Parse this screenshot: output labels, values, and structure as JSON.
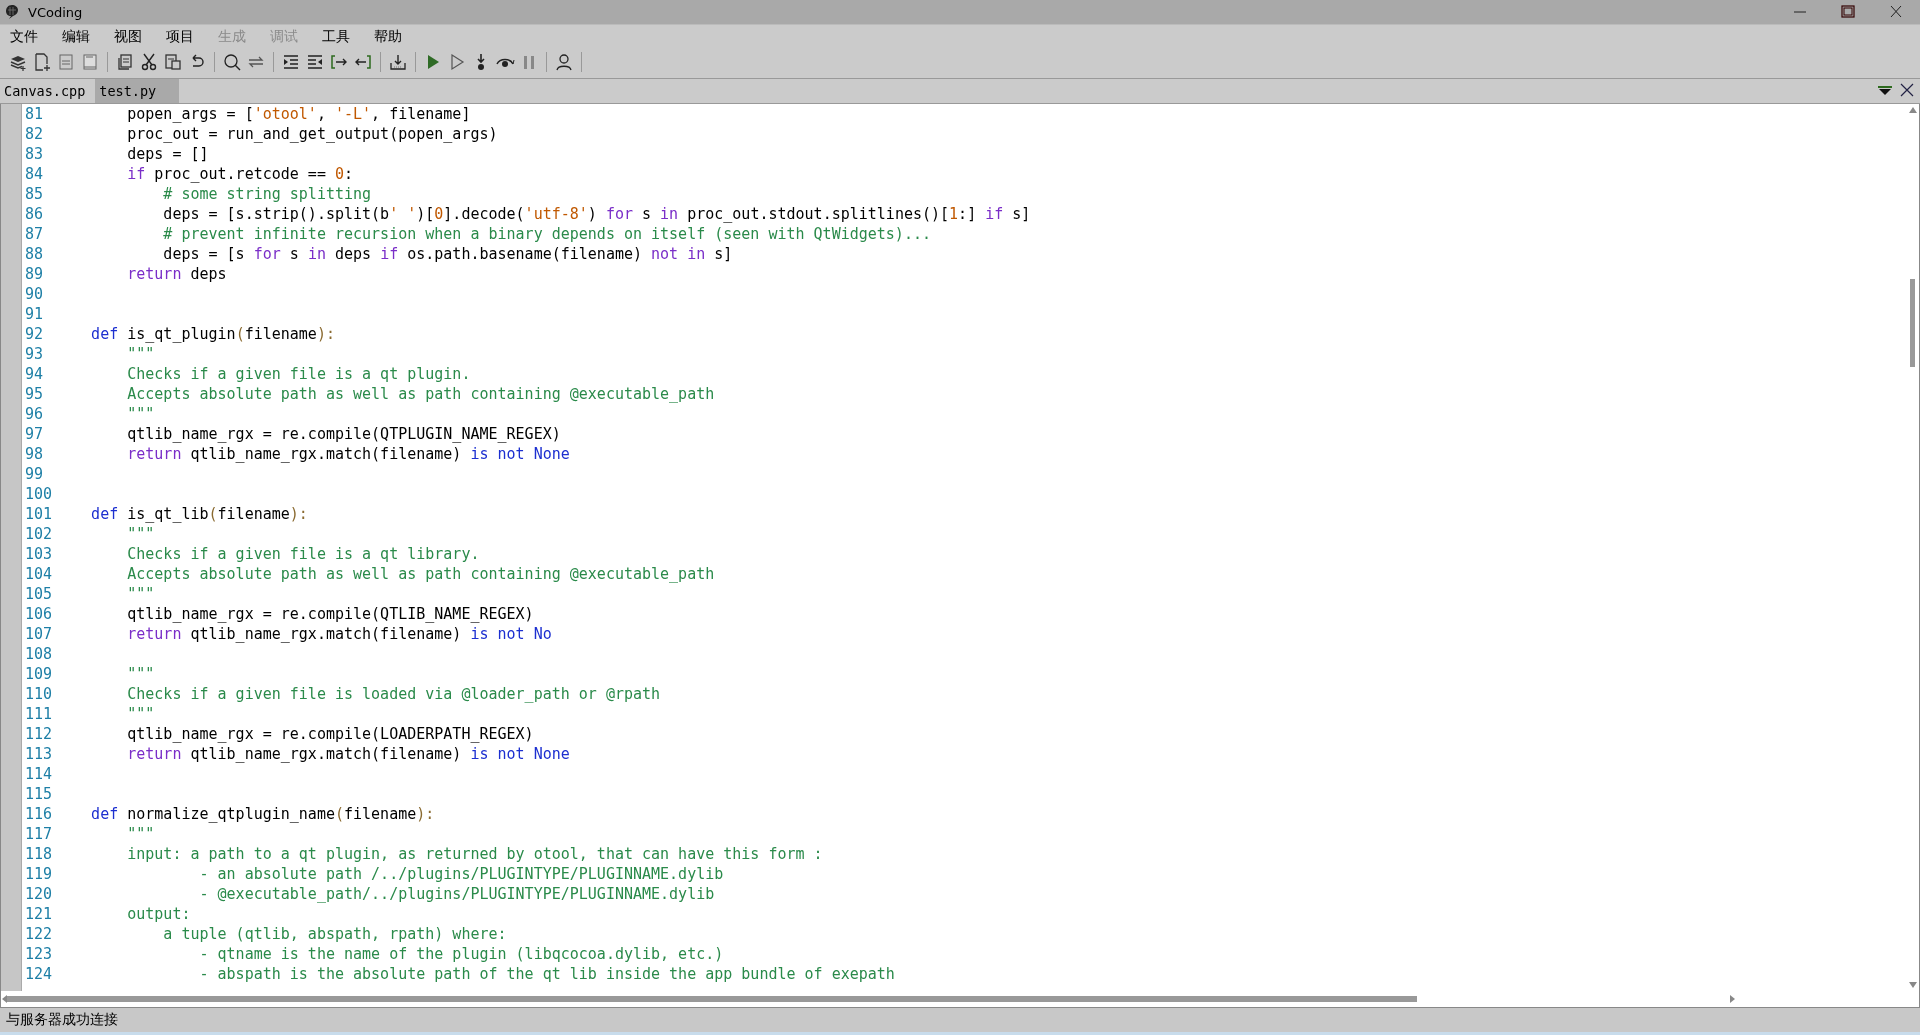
{
  "window": {
    "title": "VCoding"
  },
  "menu": [
    {
      "label": "文件",
      "disabled": false
    },
    {
      "label": "编辑",
      "disabled": false
    },
    {
      "label": "视图",
      "disabled": false
    },
    {
      "label": "项目",
      "disabled": false
    },
    {
      "label": "生成",
      "disabled": true
    },
    {
      "label": "调试",
      "disabled": true
    },
    {
      "label": "工具",
      "disabled": false
    },
    {
      "label": "帮助",
      "disabled": false
    }
  ],
  "tabs": [
    {
      "label": "Canvas.cpp",
      "selected": false
    },
    {
      "label": "test.py",
      "selected": true
    }
  ],
  "editor": {
    "lines": [
      {
        "number": "81",
        "tokens": [
          {
            "kind": "plain",
            "text": "        popen_args = ["
          },
          {
            "kind": "string",
            "text": "'otool'"
          },
          {
            "kind": "plain",
            "text": ", "
          },
          {
            "kind": "string",
            "text": "'-L'"
          },
          {
            "kind": "plain",
            "text": ", filename]"
          }
        ]
      },
      {
        "number": "82",
        "tokens": [
          {
            "kind": "plain",
            "text": "        proc_out = run_and_get_output(popen_args)"
          }
        ]
      },
      {
        "number": "83",
        "tokens": [
          {
            "kind": "plain",
            "text": "        deps = []"
          }
        ]
      },
      {
        "number": "84",
        "tokens": [
          {
            "kind": "control",
            "text": "        if"
          },
          {
            "kind": "plain",
            "text": " proc_out.retcode == "
          },
          {
            "kind": "number",
            "text": "0"
          },
          {
            "kind": "plain",
            "text": ":"
          }
        ]
      },
      {
        "number": "85",
        "tokens": [
          {
            "kind": "comment",
            "text": "            # some string splitting"
          }
        ]
      },
      {
        "number": "86",
        "tokens": [
          {
            "kind": "plain",
            "text": "            deps = [s.strip().split(b"
          },
          {
            "kind": "string",
            "text": "' '"
          },
          {
            "kind": "plain",
            "text": ")["
          },
          {
            "kind": "number",
            "text": "0"
          },
          {
            "kind": "plain",
            "text": "].decode("
          },
          {
            "kind": "string",
            "text": "'utf-8'"
          },
          {
            "kind": "plain",
            "text": ") "
          },
          {
            "kind": "control",
            "text": "for"
          },
          {
            "kind": "plain",
            "text": " s "
          },
          {
            "kind": "control",
            "text": "in"
          },
          {
            "kind": "plain",
            "text": " proc_out.stdout.splitlines()["
          },
          {
            "kind": "number",
            "text": "1"
          },
          {
            "kind": "plain",
            "text": ":] "
          },
          {
            "kind": "control",
            "text": "if"
          },
          {
            "kind": "plain",
            "text": " s]"
          }
        ]
      },
      {
        "number": "87",
        "tokens": [
          {
            "kind": "comment",
            "text": "            # prevent infinite recursion when a binary depends on itself (seen with QtWidgets)..."
          }
        ]
      },
      {
        "number": "88",
        "tokens": [
          {
            "kind": "plain",
            "text": "            deps = [s "
          },
          {
            "kind": "control",
            "text": "for"
          },
          {
            "kind": "plain",
            "text": " s "
          },
          {
            "kind": "control",
            "text": "in"
          },
          {
            "kind": "plain",
            "text": " deps "
          },
          {
            "kind": "control",
            "text": "if"
          },
          {
            "kind": "plain",
            "text": " os.path.basename(filename) "
          },
          {
            "kind": "control",
            "text": "not in"
          },
          {
            "kind": "plain",
            "text": " s]"
          }
        ]
      },
      {
        "number": "89",
        "tokens": [
          {
            "kind": "control",
            "text": "        return"
          },
          {
            "kind": "plain",
            "text": " deps"
          }
        ]
      },
      {
        "number": "90"
      },
      {
        "number": "91"
      },
      {
        "number": "92",
        "tokens": [
          {
            "kind": "keyword",
            "text": "    def"
          },
          {
            "kind": "plain",
            "text": " is_qt_plugin"
          },
          {
            "kind": "punct",
            "text": "("
          },
          {
            "kind": "plain",
            "text": "filename"
          },
          {
            "kind": "punct",
            "text": "):"
          }
        ]
      },
      {
        "number": "93",
        "tokens": [
          {
            "kind": "comment",
            "text": "        \"\"\""
          }
        ]
      },
      {
        "number": "94",
        "tokens": [
          {
            "kind": "comment",
            "text": "        Checks if a given file is a qt plugin."
          }
        ]
      },
      {
        "number": "95",
        "tokens": [
          {
            "kind": "comment",
            "text": "        Accepts absolute path as well as path containing @executable_path"
          }
        ]
      },
      {
        "number": "96",
        "tokens": [
          {
            "kind": "comment",
            "text": "        \"\"\""
          }
        ]
      },
      {
        "number": "97",
        "tokens": [
          {
            "kind": "plain",
            "text": "        qtlib_name_rgx = re.compile(QTPLUGIN_NAME_REGEX)"
          }
        ]
      },
      {
        "number": "98",
        "tokens": [
          {
            "kind": "control",
            "text": "        return"
          },
          {
            "kind": "plain",
            "text": " qtlib_name_rgx.match(filename) "
          },
          {
            "kind": "keyword",
            "text": "is not None"
          }
        ]
      },
      {
        "number": "99"
      },
      {
        "number": "100"
      },
      {
        "number": "101",
        "tokens": [
          {
            "kind": "keyword",
            "text": "    def"
          },
          {
            "kind": "plain",
            "text": " is_qt_lib"
          },
          {
            "kind": "punct",
            "text": "("
          },
          {
            "kind": "plain",
            "text": "filename"
          },
          {
            "kind": "punct",
            "text": "):"
          }
        ]
      },
      {
        "number": "102",
        "tokens": [
          {
            "kind": "comment",
            "text": "        \"\"\""
          }
        ]
      },
      {
        "number": "103",
        "tokens": [
          {
            "kind": "comment",
            "text": "        Checks if a given file is a qt library."
          }
        ]
      },
      {
        "number": "104",
        "tokens": [
          {
            "kind": "comment",
            "text": "        Accepts absolute path as well as path containing @executable_path"
          }
        ]
      },
      {
        "number": "105",
        "tokens": [
          {
            "kind": "comment",
            "text": "        \"\"\""
          }
        ]
      },
      {
        "number": "106",
        "tokens": [
          {
            "kind": "plain",
            "text": "        qtlib_name_rgx = re.compile(QTLIB_NAME_REGEX)"
          }
        ]
      },
      {
        "number": "107",
        "tokens": [
          {
            "kind": "control",
            "text": "        return"
          },
          {
            "kind": "plain",
            "text": " qtlib_name_rgx.match(filename) "
          },
          {
            "kind": "keyword",
            "text": "is not No"
          }
        ]
      },
      {
        "number": "108"
      },
      {
        "number": "109",
        "tokens": [
          {
            "kind": "comment",
            "text": "        \"\"\""
          }
        ]
      },
      {
        "number": "110",
        "tokens": [
          {
            "kind": "comment",
            "text": "        Checks if a given file is loaded via @loader_path or @rpath"
          }
        ]
      },
      {
        "number": "111",
        "tokens": [
          {
            "kind": "comment",
            "text": "        \"\"\""
          }
        ]
      },
      {
        "number": "112",
        "tokens": [
          {
            "kind": "plain",
            "text": "        qtlib_name_rgx = re.compile(LOADERPATH_REGEX)"
          }
        ]
      },
      {
        "number": "113",
        "tokens": [
          {
            "kind": "control",
            "text": "        return"
          },
          {
            "kind": "plain",
            "text": " qtlib_name_rgx.match(filename) "
          },
          {
            "kind": "keyword",
            "text": "is not None"
          }
        ]
      },
      {
        "number": "114"
      },
      {
        "number": "115"
      },
      {
        "number": "116",
        "tokens": [
          {
            "kind": "keyword",
            "text": "    def"
          },
          {
            "kind": "plain",
            "text": " normalize_qtplugin_name"
          },
          {
            "kind": "punct",
            "text": "("
          },
          {
            "kind": "plain",
            "text": "filename"
          },
          {
            "kind": "punct",
            "text": "):"
          }
        ]
      },
      {
        "number": "117",
        "tokens": [
          {
            "kind": "comment",
            "text": "        \"\"\""
          }
        ]
      },
      {
        "number": "118",
        "tokens": [
          {
            "kind": "comment",
            "text": "        input: a path to a qt plugin, as returned by otool, that can have this form :"
          }
        ]
      },
      {
        "number": "119",
        "tokens": [
          {
            "kind": "comment",
            "text": "                - an absolute path /../plugins/PLUGINTYPE/PLUGINNAME.dylib"
          }
        ]
      },
      {
        "number": "120",
        "tokens": [
          {
            "kind": "comment",
            "text": "                - @executable_path/../plugins/PLUGINTYPE/PLUGINNAME.dylib"
          }
        ]
      },
      {
        "number": "121",
        "tokens": [
          {
            "kind": "comment",
            "text": "        output:"
          }
        ]
      },
      {
        "number": "122",
        "tokens": [
          {
            "kind": "comment",
            "text": "            a tuple (qtlib, abspath, rpath) where:"
          }
        ]
      },
      {
        "number": "123",
        "tokens": [
          {
            "kind": "comment",
            "text": "                - qtname is the name of the plugin (libqcocoa.dylib, etc.)"
          }
        ]
      },
      {
        "number": "124",
        "tokens": [
          {
            "kind": "comment",
            "text": "                - abspath is the absolute path of the qt lib inside the app bundle of exepath"
          }
        ]
      }
    ]
  },
  "status_bar": {
    "text": "与服务器成功连接"
  }
}
